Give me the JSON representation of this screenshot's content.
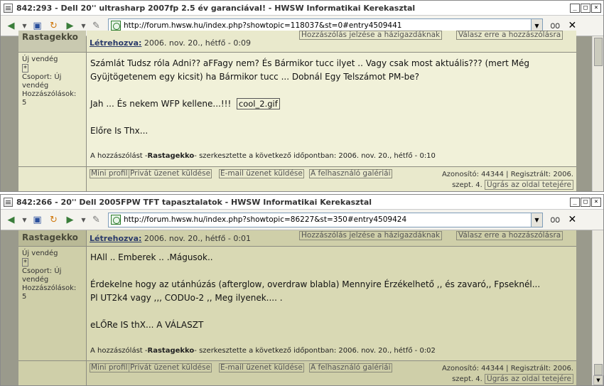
{
  "win1": {
    "title": "842:293 - Dell 20'' ultrasharp 2007fp 2.5 év garanciával! - HWSW Informatikai Kerekasztal",
    "url": "http://forum.hwsw.hu/index.php?showtopic=118037&st=0#entry4509441",
    "post": {
      "author": "Rastagekko",
      "created_label": "Létrehozva:",
      "created_date": "2006. nov. 20., hétfő - 0:09",
      "report_btn": "Hozzászólás jelzése a házigazdáknak",
      "reply_btn": "Válasz erre a hozzászólásra",
      "group_line1": "Új vendég",
      "star": "*",
      "group_line2": "Csoport: Új",
      "group_line3": "vendég",
      "posts_label": "Hozzászólások:",
      "posts_count": "5",
      "body": [
        "Számlát Tudsz róla Adni?? aFFagy nem?  És Bármikor tucc ilyet .. Vagy csak most aktuális??? (mert Még",
        "Gyüjtögetenem egy kicsit) ha Bármikor tucc ... Dobnál Egy Telszámot PM-be?",
        "",
        "Jah ... És nekem WFP kellene...!!!"
      ],
      "gif_name": "cool_2.gif",
      "body_end": "Előre Is Thx...",
      "edit_pre": "A hozzászólást -",
      "edit_user": "Rastagekko",
      "edit_post": "- szerkesztette a következő időpontban: 2006. nov. 20., hétfő - 0:10",
      "foot_btns": [
        "Mini profil",
        "Privát üzenet küldése",
        "E-mail üzenet küldése",
        "A felhasználó galériái"
      ],
      "id_text": "Azonosító: 44344 | Regisztrált: 2006.",
      "id_text2": "szept. 4.",
      "top_btn": "Ugrás az oldal tetejére"
    }
  },
  "win2": {
    "title": "842:266 - 20'' Dell 2005FPW TFT tapasztalatok - HWSW Informatikai Kerekasztal",
    "url": "http://forum.hwsw.hu/index.php?showtopic=86227&st=350#entry4509424",
    "post": {
      "author": "Rastagekko",
      "created_label": "Létrehozva:",
      "created_date": "2006. nov. 20., hétfő - 0:01",
      "report_btn": "Hozzászólás jelzése a házigazdáknak",
      "reply_btn": "Válasz erre a hozzászólásra",
      "group_line1": "Új vendég",
      "star": "*",
      "group_line2": "Csoport: Új",
      "group_line3": "vendég",
      "posts_label": "Hozzászólások:",
      "posts_count": "5",
      "body": [
        "HAll .. Emberek .. .Mágusok..",
        "",
        "Érdekelne hogy az utánhúzás (afterglow, overdraw blabla) Mennyire Érzékelhető ,, és zavaró,, Fpseknél...",
        "Pl UT2k4 vagy ,,, CODUo-2 ,, Meg ilyenek.... .",
        "",
        "eLŐRe IS thX... A VÁLASZT"
      ],
      "edit_pre": "A hozzászólást -",
      "edit_user": "Rastagekko",
      "edit_post": "- szerkesztette a következő időpontban: 2006. nov. 20., hétfő - 0:02",
      "foot_btns": [
        "Mini profil",
        "Privát üzenet küldése",
        "E-mail üzenet küldése",
        "A felhasználó galériái"
      ],
      "id_text": "Azonosító: 44344 | Regisztrált: 2006.",
      "id_text2": "szept. 4.",
      "top_btn": "Ugrás az oldal tetejére"
    }
  },
  "icons": {
    "back": "back-arrow-icon",
    "forward": "forward-arrow-icon",
    "save": "save-icon",
    "reload": "reload-icon",
    "edit": "pen-icon",
    "page": "page-icon",
    "glasses": "glasses-icon",
    "close": "close-icon"
  }
}
